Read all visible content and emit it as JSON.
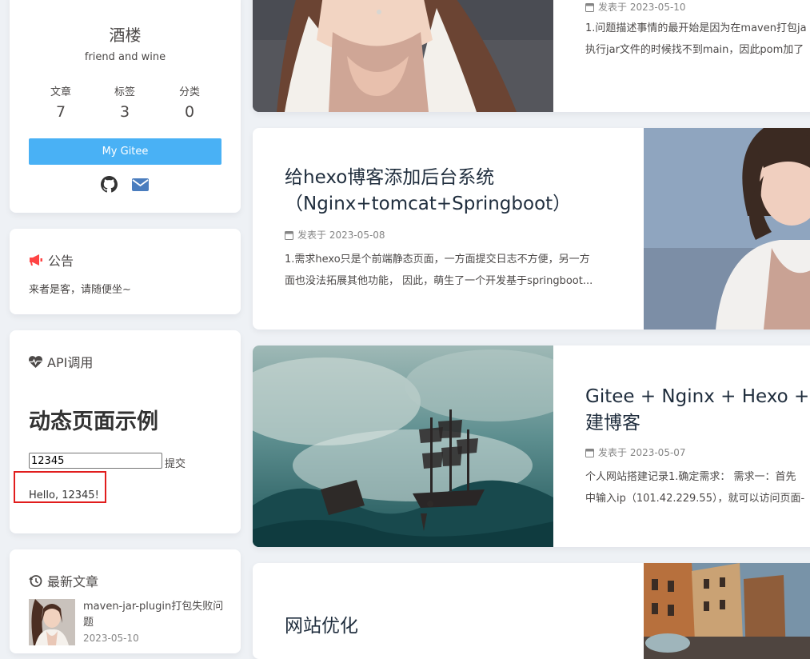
{
  "profile": {
    "name": "酒楼",
    "description": "friend and wine",
    "stats": [
      {
        "label": "文章",
        "value": "7"
      },
      {
        "label": "标签",
        "value": "3"
      },
      {
        "label": "分类",
        "value": "0"
      }
    ],
    "button_label": "My Gitee",
    "social_icons": [
      "github-icon",
      "envelope-icon"
    ]
  },
  "announcement": {
    "title": "公告",
    "content": "来者是客，请随便坐~"
  },
  "api_card": {
    "title": "API调用",
    "heading": "动态页面示例",
    "input_value": "12345",
    "submit_label": "提交",
    "result": "Hello, 12345!"
  },
  "recent": {
    "title": "最新文章",
    "items": [
      {
        "title": "maven-jar-plugin打包失败问题",
        "date": "2023-05-10"
      }
    ]
  },
  "posts": [
    {
      "date": "发表于 2023-05-10",
      "excerpt_lines": [
        "1.问题描述事情的最开始是因为在maven打包ja",
        "执行jar文件的时候找不到main，因此pom加了"
      ]
    },
    {
      "title_lines": [
        "给hexo博客添加后台系统",
        "（Nginx+tomcat+Springboot）"
      ],
      "date": "发表于 2023-05-08",
      "excerpt_lines": [
        "1.需求hexo只是个前端静态页面，一方面提交日志不方便，另一方",
        "面也没法拓展其他功能， 因此，萌生了一个开发基于springboot..."
      ]
    },
    {
      "title_lines": [
        "Gitee + Nginx + Hexo +Le",
        "建博客"
      ],
      "date": "发表于 2023-05-07",
      "excerpt_lines": [
        "个人网站搭建记录1.确定需求：  需求一：首先",
        "中输入ip（101.42.229.55），就可以访问页面-"
      ]
    },
    {
      "title_lines": [
        "网站优化"
      ]
    }
  ],
  "colors": {
    "accent": "#49b1f5",
    "announcement_icon": "#ff4444",
    "highlight_box": "#e11d1d"
  }
}
